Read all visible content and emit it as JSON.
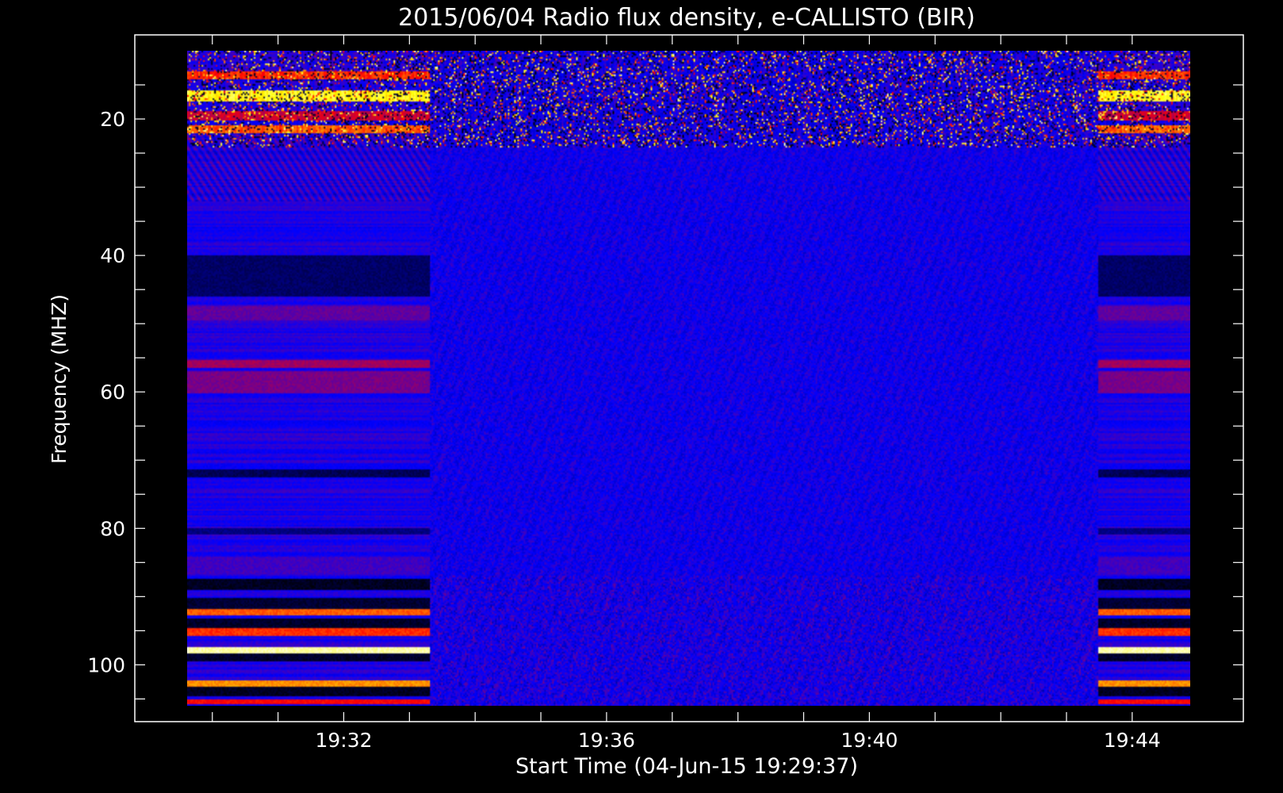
{
  "chart_data": {
    "type": "heatmap",
    "title": "2015/06/04  Radio flux density, e-CALLISTO (BIR)",
    "xlabel": "Start Time (04-Jun-15 19:29:37)",
    "ylabel": "Frequency (MHZ)",
    "x_range": [
      "19:29:37",
      "19:44:53"
    ],
    "y_range": [
      10,
      106
    ],
    "y_inverted": true,
    "x_ticks": [
      {
        "label": "19:32",
        "minutes": 32
      },
      {
        "label": "19:36",
        "minutes": 36
      },
      {
        "label": "19:40",
        "minutes": 40
      },
      {
        "label": "19:44",
        "minutes": 44
      }
    ],
    "y_ticks": [
      20,
      40,
      60,
      80,
      100
    ],
    "colormap": [
      "#000000",
      "#0000ff",
      "#ff0000",
      "#ffff00",
      "#ffffff"
    ],
    "background_color": "#000000",
    "segments": [
      {
        "start": "19:29:37",
        "end": "19:33:18",
        "level": "high-contrast"
      },
      {
        "start": "19:33:18",
        "end": "19:43:29",
        "level": "low-contrast"
      },
      {
        "start": "19:43:29",
        "end": "19:44:53",
        "level": "high-contrast"
      }
    ]
  }
}
